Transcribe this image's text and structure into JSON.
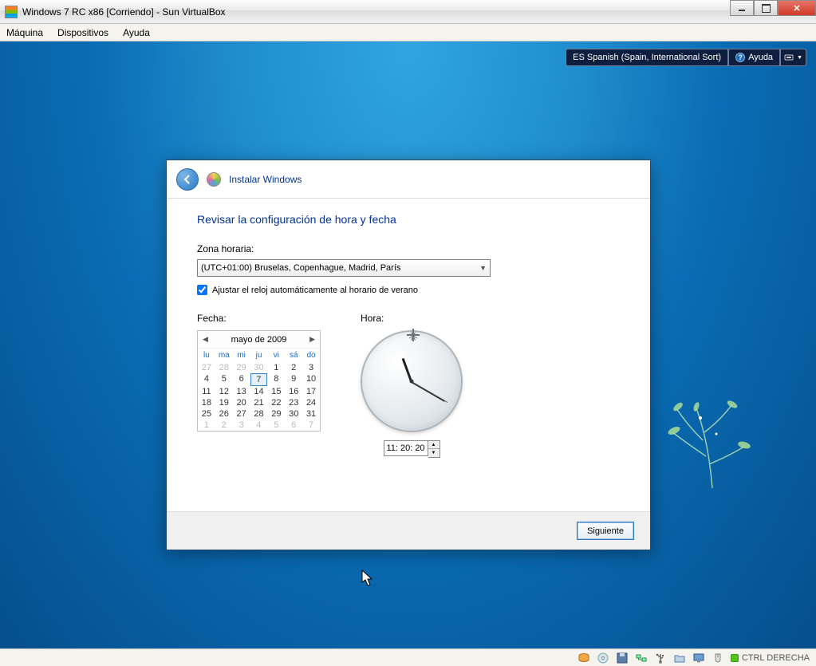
{
  "vbox": {
    "title": "Windows 7 RC x86 [Corriendo] - Sun VirtualBox",
    "menu": {
      "maquina": "Máquina",
      "dispositivos": "Dispositivos",
      "ayuda": "Ayuda"
    },
    "statusbar": {
      "ctrl_key": "CTRL DERECHA"
    }
  },
  "lang_bar": {
    "language": "ES Spanish (Spain, International Sort)",
    "help": "Ayuda"
  },
  "wizard": {
    "title": "Instalar Windows",
    "heading": "Revisar la configuración de hora y fecha",
    "timezone": {
      "label": "Zona horaria:",
      "selected": "(UTC+01:00) Bruselas, Copenhague, Madrid, París"
    },
    "dst_checkbox": {
      "checked": true,
      "label": "Ajustar el reloj automáticamente al horario de verano"
    },
    "date": {
      "label": "Fecha:",
      "month_year": "mayo de 2009",
      "day_headers": [
        "lu",
        "ma",
        "mi",
        "ju",
        "vi",
        "sá",
        "do"
      ],
      "leading_muted": [
        27,
        28,
        29,
        30
      ],
      "days": [
        1,
        2,
        3,
        4,
        5,
        6,
        7,
        8,
        9,
        10,
        11,
        12,
        13,
        14,
        15,
        16,
        17,
        18,
        19,
        20,
        21,
        22,
        23,
        24,
        25,
        26,
        27,
        28,
        29,
        30,
        31
      ],
      "trailing_muted": [
        1,
        2,
        3,
        4,
        5,
        6,
        7
      ],
      "selected_day": 7
    },
    "time": {
      "label": "Hora:",
      "value": "11: 20: 20",
      "hour": 11,
      "minute": 20,
      "second": 20
    },
    "next_button": "Siguiente"
  }
}
